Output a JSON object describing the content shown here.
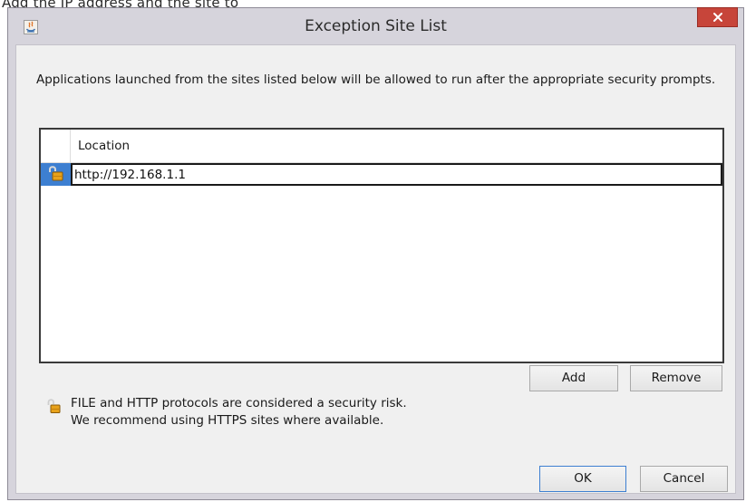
{
  "behind_window": {
    "partial_text": "Add the IP address and the site to"
  },
  "window": {
    "title": "Exception Site List",
    "app_icon": "java-icon",
    "close_icon": "close-icon",
    "close_color": "#c7453a"
  },
  "dialog": {
    "description": "Applications launched from the sites listed below will be allowed to run after the appropriate security prompts.",
    "table": {
      "header": {
        "location": "Location"
      },
      "rows": [
        {
          "icon": "unlocked-padlock-icon",
          "location": "http://192.168.1.1"
        }
      ],
      "selection_color": "#3d7fd1"
    },
    "buttons": {
      "add": "Add",
      "remove": "Remove",
      "ok": "OK",
      "cancel": "Cancel"
    },
    "warning": {
      "icon": "unlocked-padlock-icon",
      "line1": "FILE and HTTP protocols are considered a security risk.",
      "line2": "We recommend using HTTPS sites where available."
    }
  }
}
